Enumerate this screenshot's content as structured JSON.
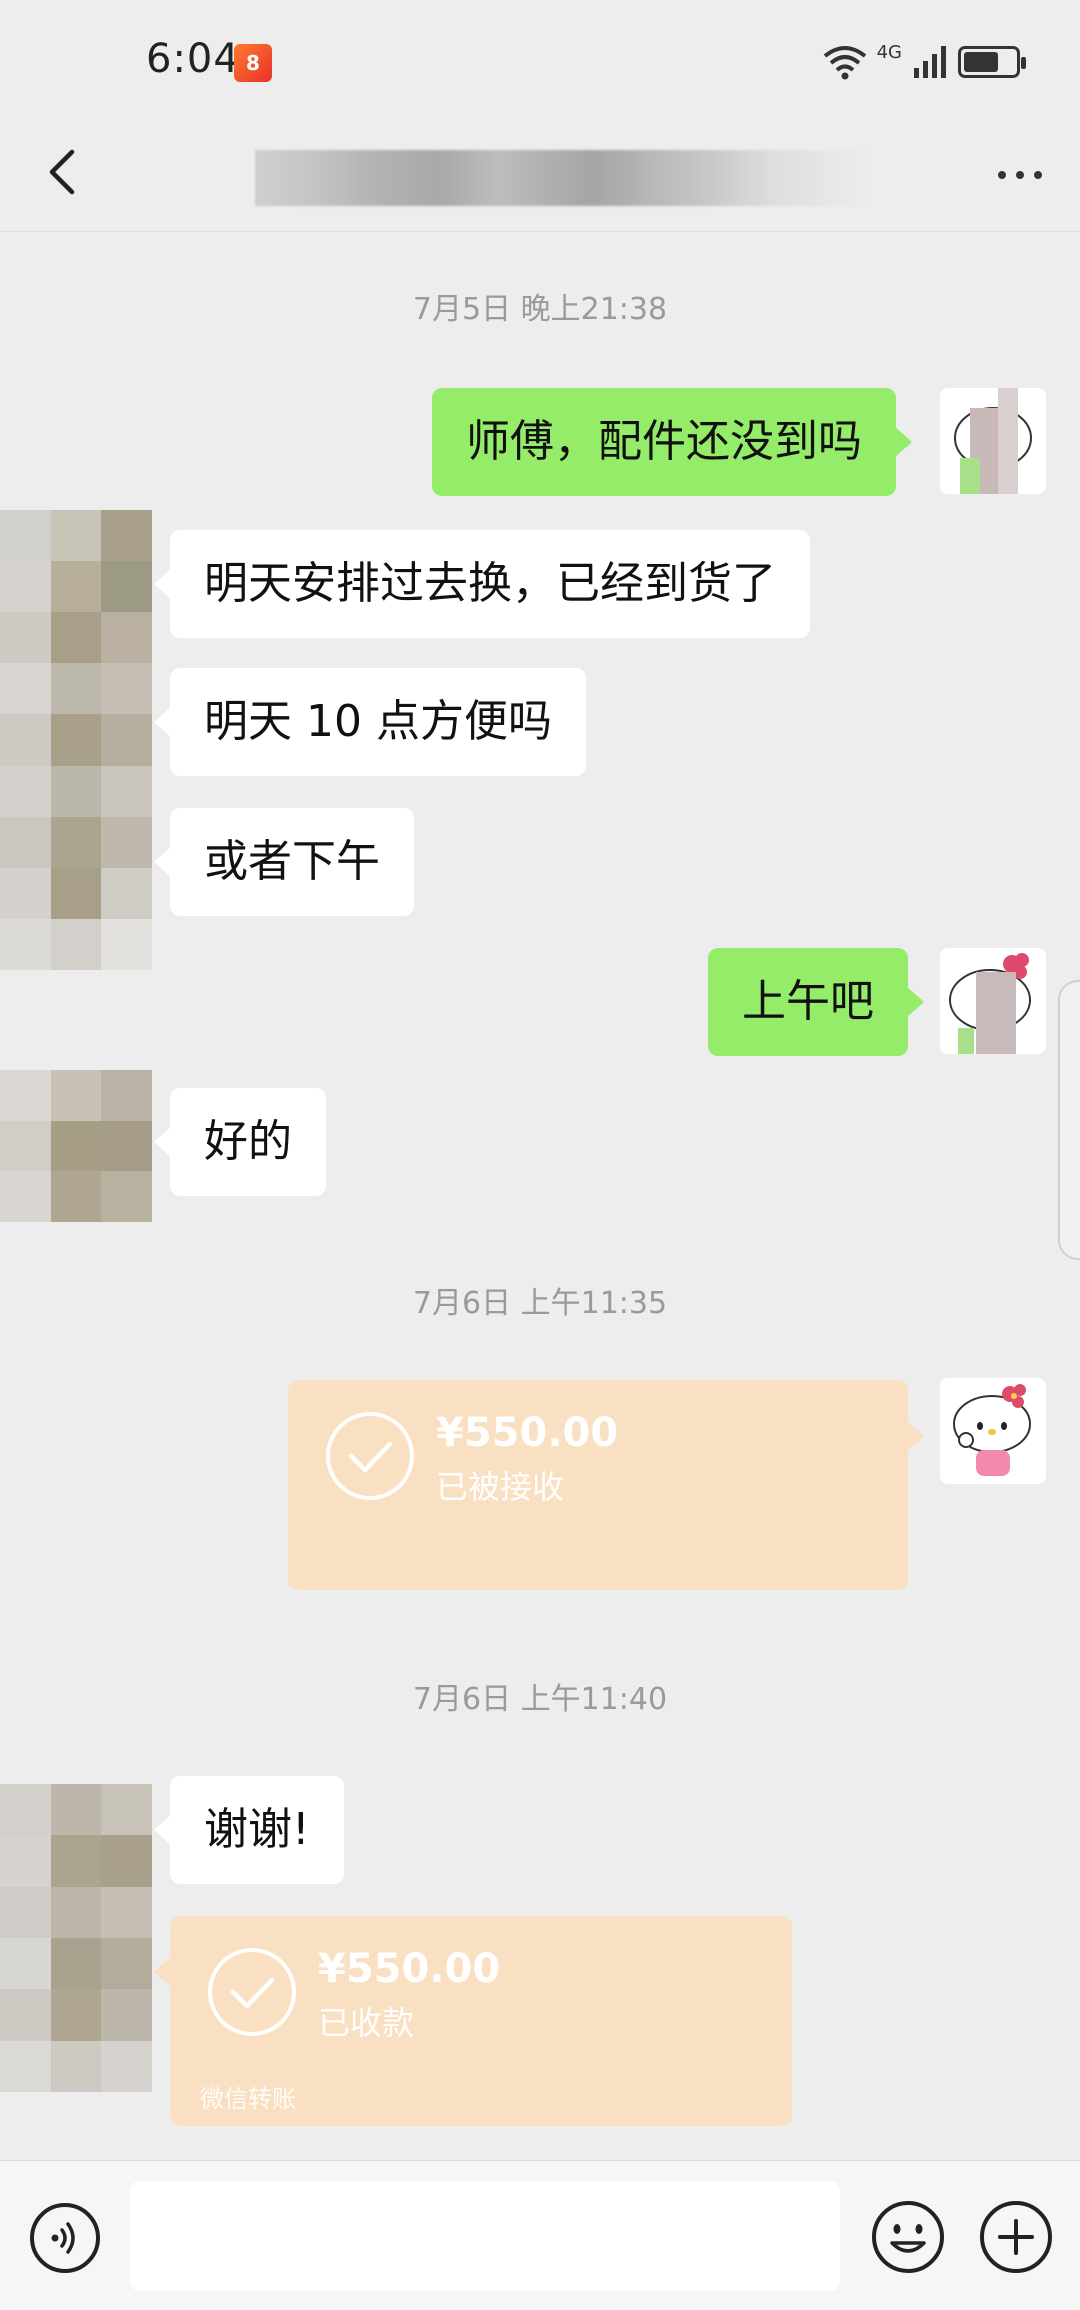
{
  "status_bar": {
    "time": "6:04",
    "network": "4G",
    "app_badge_icon": "app-notification-icon"
  },
  "header": {
    "back_icon": "chevron-left-icon",
    "more_icon": "more-dots-icon"
  },
  "messages": [
    {
      "type": "timestamp",
      "text": "7月5日 晚上21:38"
    },
    {
      "type": "text",
      "side": "right",
      "text": "师傅，配件还没到吗"
    },
    {
      "type": "text",
      "side": "left",
      "text": "明天安排过去换，已经到货了"
    },
    {
      "type": "text",
      "side": "left",
      "text": "明天 10 点方便吗"
    },
    {
      "type": "text",
      "side": "left",
      "text": "或者下午"
    },
    {
      "type": "text",
      "side": "right",
      "text": "上午吧"
    },
    {
      "type": "text",
      "side": "left",
      "text": "好的"
    },
    {
      "type": "timestamp",
      "text": "7月6日 上午11:35"
    },
    {
      "type": "transfer",
      "side": "right",
      "amount": "¥550.00",
      "status": "已被接收"
    },
    {
      "type": "timestamp",
      "text": "7月6日 上午11:40"
    },
    {
      "type": "text",
      "side": "left",
      "text": "谢谢!"
    },
    {
      "type": "transfer",
      "side": "left",
      "amount": "¥550.00",
      "status": "已收款",
      "footer": "微信转账"
    }
  ],
  "input_bar": {
    "voice_icon": "voice-icon",
    "emoji_icon": "emoji-icon",
    "plus_icon": "plus-icon",
    "input_value": ""
  },
  "colors": {
    "background": "#ededed",
    "outgoing_bubble": "#95ec69",
    "incoming_bubble": "#ffffff",
    "transfer_card": "#fae0c2"
  }
}
